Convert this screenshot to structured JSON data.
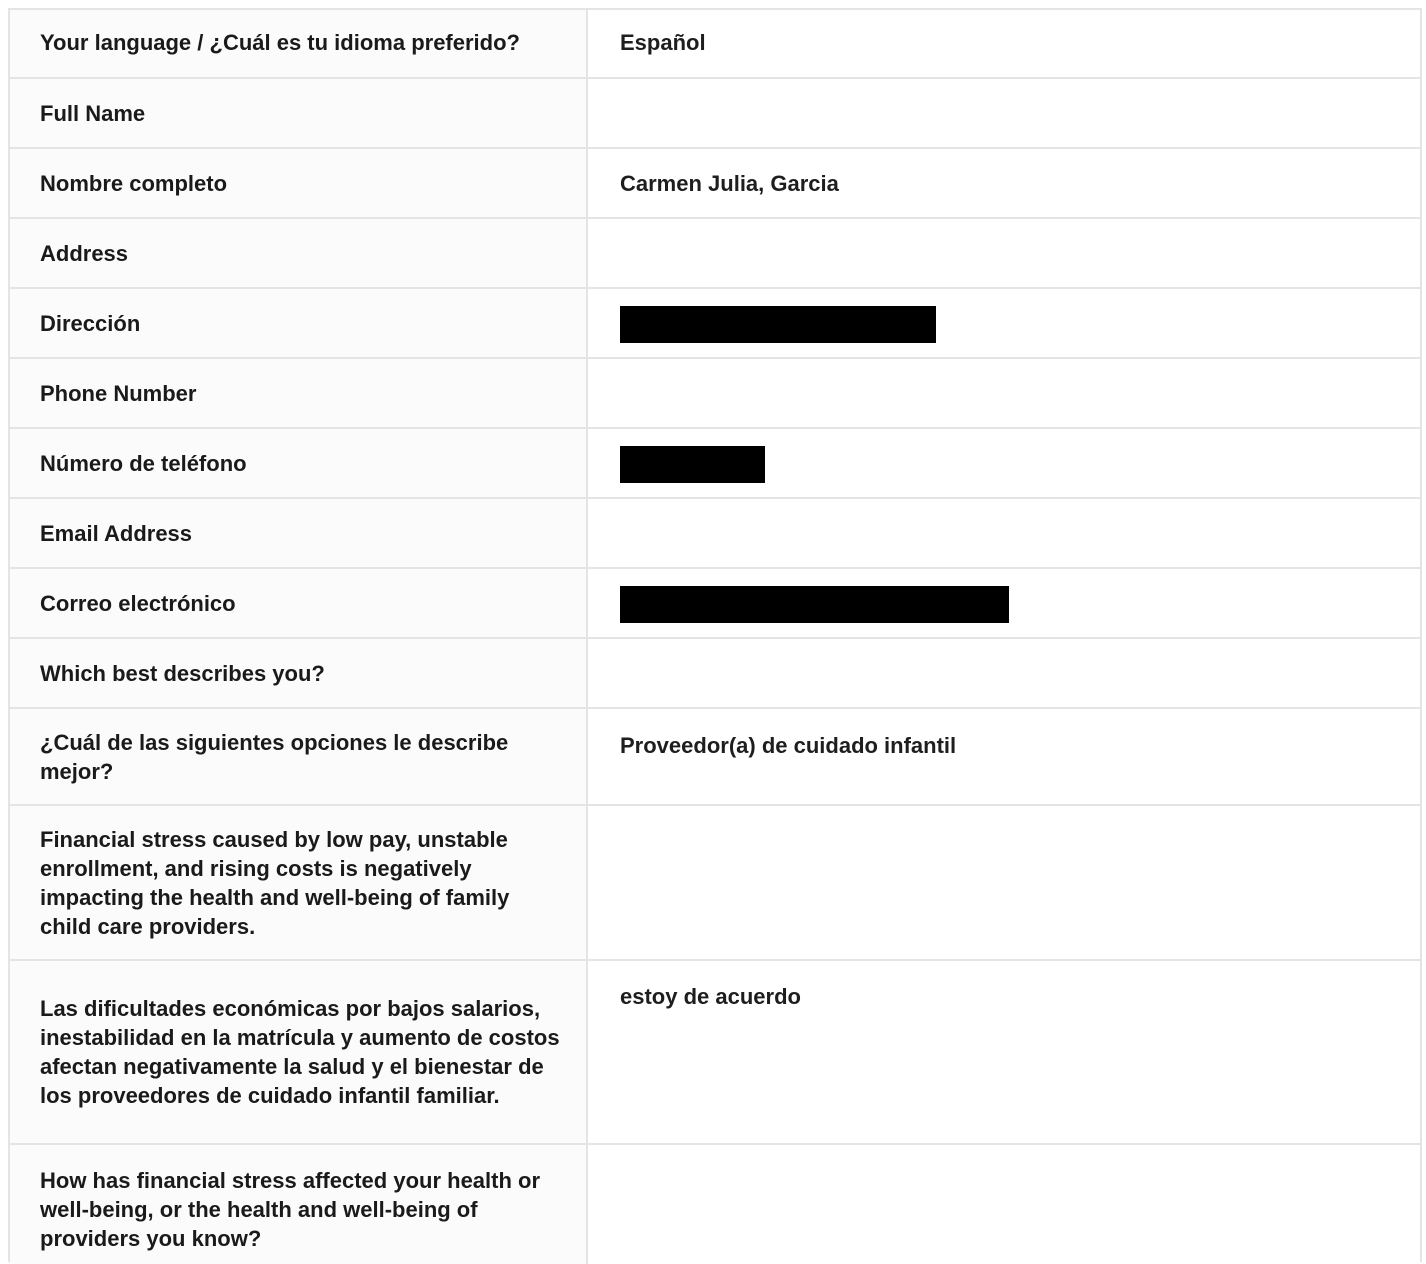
{
  "form": {
    "rows": [
      {
        "label": "Your language / ¿Cuál es tu idioma preferido?",
        "value": "Español"
      },
      {
        "label": "Full Name",
        "value": ""
      },
      {
        "label": "Nombre completo",
        "value": "Carmen Julia, Garcia"
      },
      {
        "label": "Address",
        "value": ""
      },
      {
        "label": "Dirección",
        "value": "[redacted]"
      },
      {
        "label": "Phone Number",
        "value": ""
      },
      {
        "label": "Número de teléfono",
        "value": "[redacted]"
      },
      {
        "label": "Email Address",
        "value": ""
      },
      {
        "label": "Correo electrónico",
        "value": "[redacted]"
      },
      {
        "label": "Which best describes you?",
        "value": ""
      },
      {
        "label": "¿Cuál de las siguientes opciones le describe mejor?",
        "value": "Proveedor(a) de cuidado infantil"
      },
      {
        "label": "Financial stress caused by low pay, unstable enrollment, and rising costs is negatively impacting the health and well-being of family child care providers.",
        "value": ""
      },
      {
        "label": "Las dificultades económicas por bajos salarios, inestabilidad en la matrícula y aumento de costos afectan negativamente la salud y el bienestar de los proveedores de cuidado infantil familiar.",
        "value": "estoy de acuerdo"
      },
      {
        "label": "How has financial stress affected your health or well-being, or the health and well-being of providers you know?",
        "value": ""
      }
    ]
  }
}
